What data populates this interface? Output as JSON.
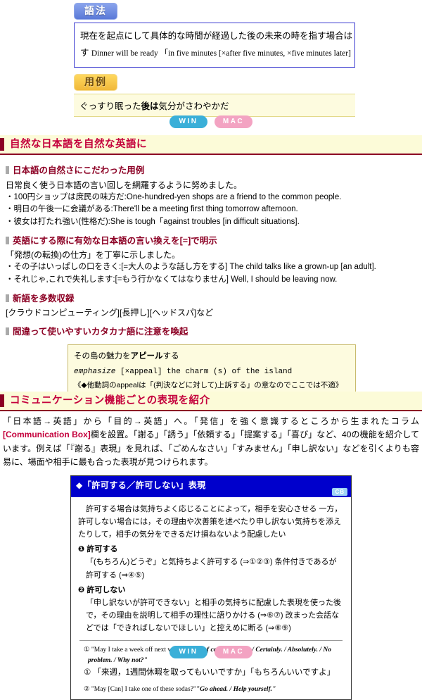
{
  "specimen": {
    "grammar_tag": "語法",
    "grammar_line1": "現在を起点にして具体的な時間が経過した後の未来の時を指す場合は",
    "grammar_line2_jp": "す",
    "grammar_line2_en": "Dinner will be ready 「in five minutes  [×after five minutes, ×five minutes later]",
    "usage_tag": "用例",
    "usage_pre": "ぐっすり眠った",
    "usage_bold": "後は",
    "usage_post": "気分がさわやかだ"
  },
  "platform": {
    "win": "WIN",
    "mac": "MAC"
  },
  "section_natural": {
    "title": "自然な日本語を自然な英語に",
    "groups": [
      {
        "sub_title": "日本語の自然さにこだわった用例",
        "lead": "日常良く使う日本語の言い回しを網羅するように努めました。",
        "lines": [
          "・100円ショップは庶民の味方だ:One-hundred-yen shops are a friend to the common people.",
          "・明日の午後一に会議がある:There'll be a meeting first thing tomorrow afternoon.",
          "・彼女は打たれ強い(性格だ):She is tough「against troubles [in difficult situations]."
        ]
      },
      {
        "sub_title": "英語にする際に有効な日本語の言い換えを[=]で明示",
        "lead": "「発想(の転換)の仕方」を丁寧に示しました。",
        "lines": [
          "・その子はいっぱしの口をきく:[=大人のような話し方をする] The child talks like a grown-up [an adult].",
          "・それじゃ,これで失礼します:[=もう行かなくてはなりません] Well, I should be leaving now."
        ]
      },
      {
        "sub_title": "新語を多数収録",
        "lead": "[クラウドコンピューティング][長押し][ヘッドスパ]など",
        "lines": []
      }
    ],
    "katakana_sub_title": "間違って使いやすいカタカナ語に注意を喚起",
    "callout": {
      "line1_pre": "その島の魅力を",
      "line1_bold": "アピール",
      "line1_post": "する",
      "line2": "emphasize  [×appeal]  the charm (s)  of the island",
      "line3": "《◆他動詞のappealは「(判決などに対して)上訴する」の意なのでここでは不適》"
    }
  },
  "section_communication": {
    "title": "コミュニケーション機能ごとの表現を紹介",
    "paragraph_part1": "「日本語→英語」から「目的→英語」へ。「発信」を強く意識するところから生まれたコラム",
    "paragraph_cbname": "[Communication Box]",
    "paragraph_part2": "欄を設置。「謝る」「誘う」「依頼する」「提案する」「喜び」など、40の機能を紹介しています。例えば「『謝る』表現」を見れば、「ごめんなさい」「すみません」「申し訳ない」などを引くよりも容易に、場面や相手に最も合った表現が見つけられます。",
    "panel": {
      "title": "◆「許可する／許可しない」表現",
      "badge": "CB",
      "intro": "許可する場合は気持ちよく応じることによって，相手を安心させる 一方，許可しない場合には，その理由や次善策を述べたり申し訳ない気持ちを添えたりして，相手の気分をできるだけ損ねないよう配慮したい",
      "items": [
        {
          "head": "❶ 許可する",
          "body": "「(もちろん)どうぞ」と気持ちよく許可する (⇒①②③) 条件付きであるが許可する (⇒④⑤)"
        },
        {
          "head": "❷ 許可しない",
          "body": "「申し訳ないが許可できない」と相手の気持ちに配慮した表現を使った後で，その理由を説明して相手の理性に語りかける (⇒⑥⑦) 改まった会話などでは「できればしないでほしい」と控えめに断る (⇒⑧⑨)"
        }
      ],
      "examples": [
        {
          "num": "①",
          "en_q": "\"May I take a week off next week?\"",
          "en_a": "\"Yes, of course. / Sure. / Certainly. / Absolutely. / No problem. / Why not?\"",
          "jp": "「来週，1週間休暇を取ってもいいですか」「もちろんいいですよ」"
        },
        {
          "num": "②",
          "en_q": "\"May [Can] I take one of these sodas?\"",
          "en_a": "\"Go ahead. / Help yourself.\"",
          "jp": ""
        }
      ]
    }
  },
  "colors": {
    "accent_red": "#c4003c",
    "bar_dark_red": "#8c0024",
    "panel_blue": "#0000cc",
    "win_blue": "#3aafd8",
    "mac_pink": "#f3a3c2",
    "yellow_band": "#fcfbd8",
    "callout_yellow": "#fdfbdf"
  }
}
